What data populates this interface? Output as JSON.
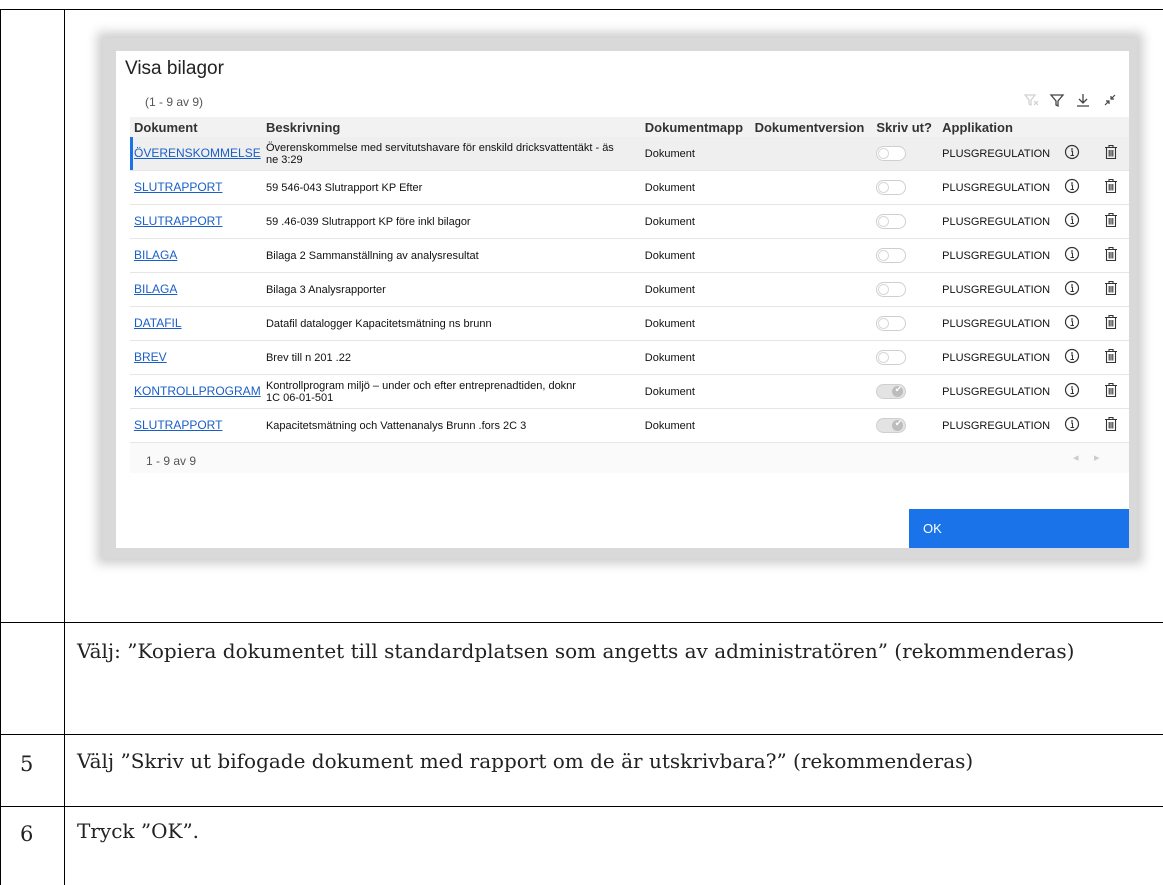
{
  "dialog": {
    "title": "Visa bilagor",
    "count_text": "(1 - 9 av 9)",
    "toolbar_icons": [
      "clear-filter-icon",
      "filter-icon",
      "download-icon",
      "collapse-icon"
    ],
    "columns": [
      "Dokument",
      "Beskrivning",
      "Dokumentmapp",
      "Dokumentversion",
      "Skriv ut?",
      "Applikation"
    ],
    "rows": [
      {
        "doc": "ÖVERENSKOMMELSE",
        "desc": "Överenskommelse med servitutshavare för enskild dricksvattentäkt -          äs\n          ne 3:29",
        "folder": "Dokument",
        "version": "",
        "print": false,
        "app": "PLUSGREGULATION"
      },
      {
        "doc": "SLUTRAPPORT",
        "desc": "59    546-043 Slutrapport KP Efter",
        "folder": "Dokument",
        "version": "",
        "print": false,
        "app": "PLUSGREGULATION"
      },
      {
        "doc": "SLUTRAPPORT",
        "desc": "59    .46-039 Slutrapport KP före inkl bilagor",
        "folder": "Dokument",
        "version": "",
        "print": false,
        "app": "PLUSGREGULATION"
      },
      {
        "doc": "BILAGA",
        "desc": "Bilaga 2 Sammanställning av analysresultat",
        "folder": "Dokument",
        "version": "",
        "print": false,
        "app": "PLUSGREGULATION"
      },
      {
        "doc": "BILAGA",
        "desc": "Bilaga 3 Analysrapporter",
        "folder": "Dokument",
        "version": "",
        "print": false,
        "app": "PLUSGREGULATION"
      },
      {
        "doc": "DATAFIL",
        "desc": "Datafil datalogger Kapacitetsmätning        ns brunn",
        "folder": "Dokument",
        "version": "",
        "print": false,
        "app": "PLUSGREGULATION"
      },
      {
        "doc": "BREV",
        "desc": "Brev till        n 201    .22",
        "folder": "Dokument",
        "version": "",
        "print": false,
        "app": "PLUSGREGULATION"
      },
      {
        "doc": "KONTROLLPROGRAM",
        "desc": "Kontrollprogram miljö – under och efter entreprenadtiden, doknr\n1C    06-01-501",
        "folder": "Dokument",
        "version": "",
        "print": true,
        "app": "PLUSGREGULATION"
      },
      {
        "doc": "SLUTRAPPORT",
        "desc": "Kapacitetsmätning och Vattenanalys Brunn      .fors 2C  3",
        "folder": "Dokument",
        "version": "",
        "print": true,
        "app": "PLUSGREGULATION"
      }
    ],
    "pager_text": "1 - 9 av 9",
    "ok_label": "OK"
  },
  "instructions": [
    {
      "num": "",
      "text": "Välj: ”Kopiera dokumentet till standardplatsen som angetts av administratören” (rekommenderas)"
    },
    {
      "num": "5",
      "text": "Välj ”Skriv ut bifogade dokument med rapport om de är utskrivbara?” (rekommenderas)"
    },
    {
      "num": "6",
      "text": "Tryck ”OK”."
    }
  ]
}
